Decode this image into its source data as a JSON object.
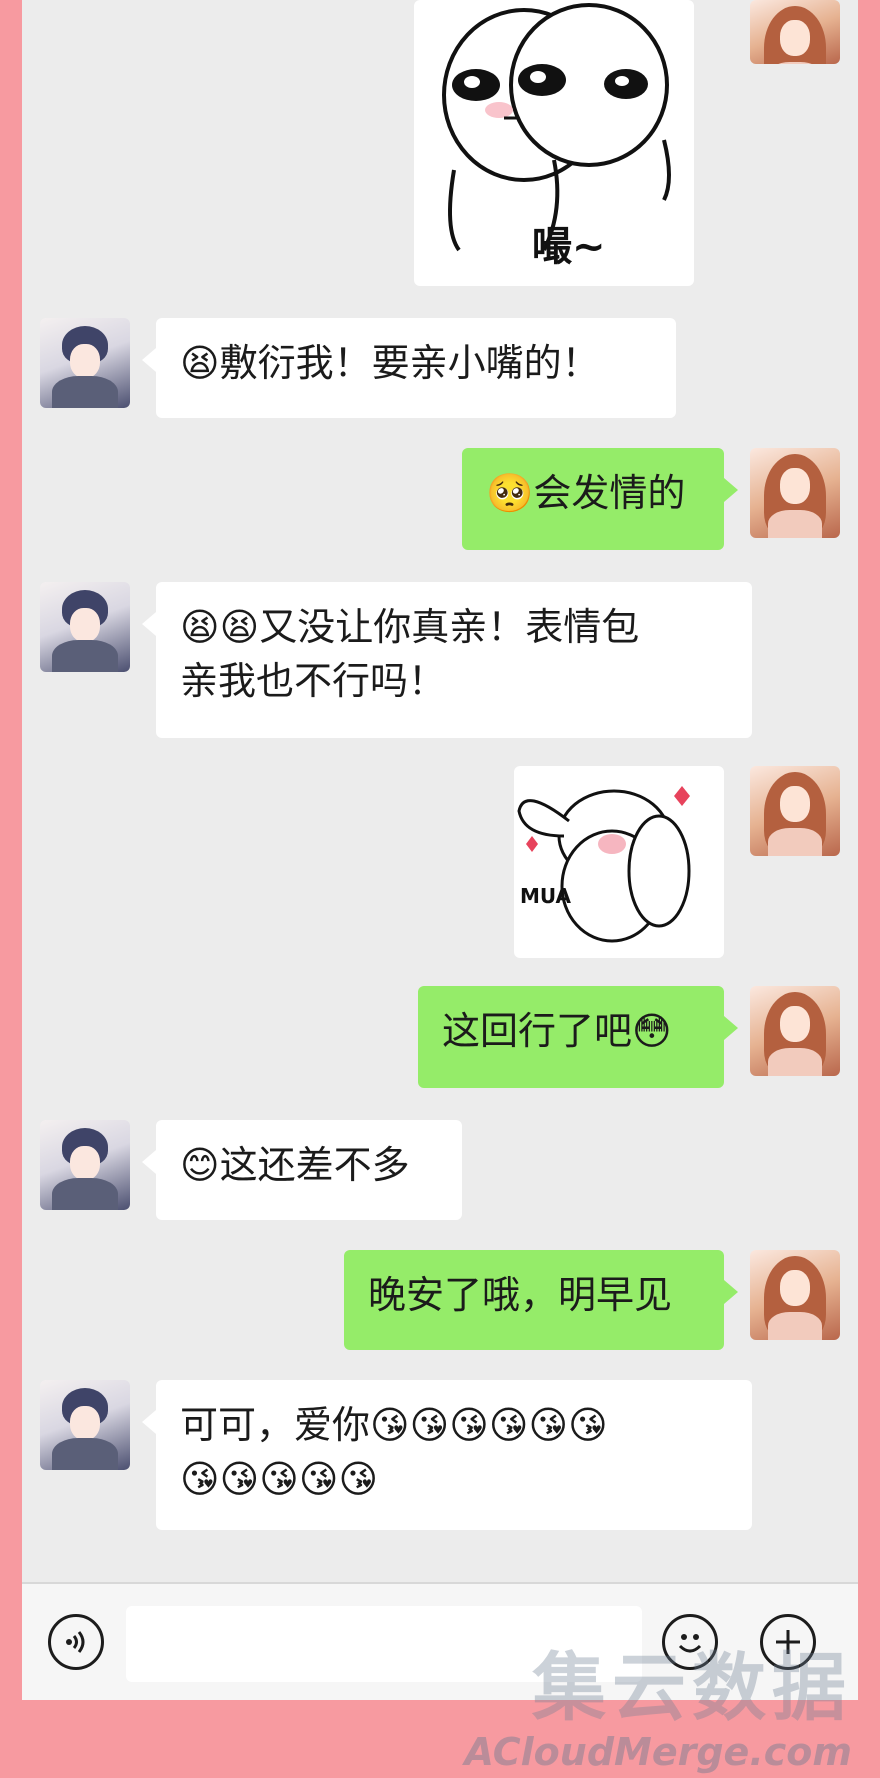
{
  "chat": {
    "sticker1_text": "嘬~",
    "msg1": "😫敷衍我！要亲小嘴的！",
    "msg2": "🥺会发情的",
    "msg3": "😫😫又没让你真亲！表情包\n亲我也不行吗！",
    "sticker2_text": "MUA",
    "msg4": "这回行了吧😳",
    "msg5": "😊这还差不多",
    "msg6": "晚安了哦，明早见",
    "msg7": "可可，爱你😘😘😘😘😘😘\n😘😘😘😘😘"
  },
  "input_bar": {
    "voice_icon": "voice-icon",
    "emoji_icon": "emoji-icon",
    "plus_icon": "plus-icon"
  },
  "watermark": {
    "cn": "集云数据",
    "en": "ACloudMerge.com"
  },
  "colors": {
    "frame": "#f79aa0",
    "chat_bg": "#ececec",
    "sent_bubble": "#95ec69",
    "received_bubble": "#ffffff"
  }
}
